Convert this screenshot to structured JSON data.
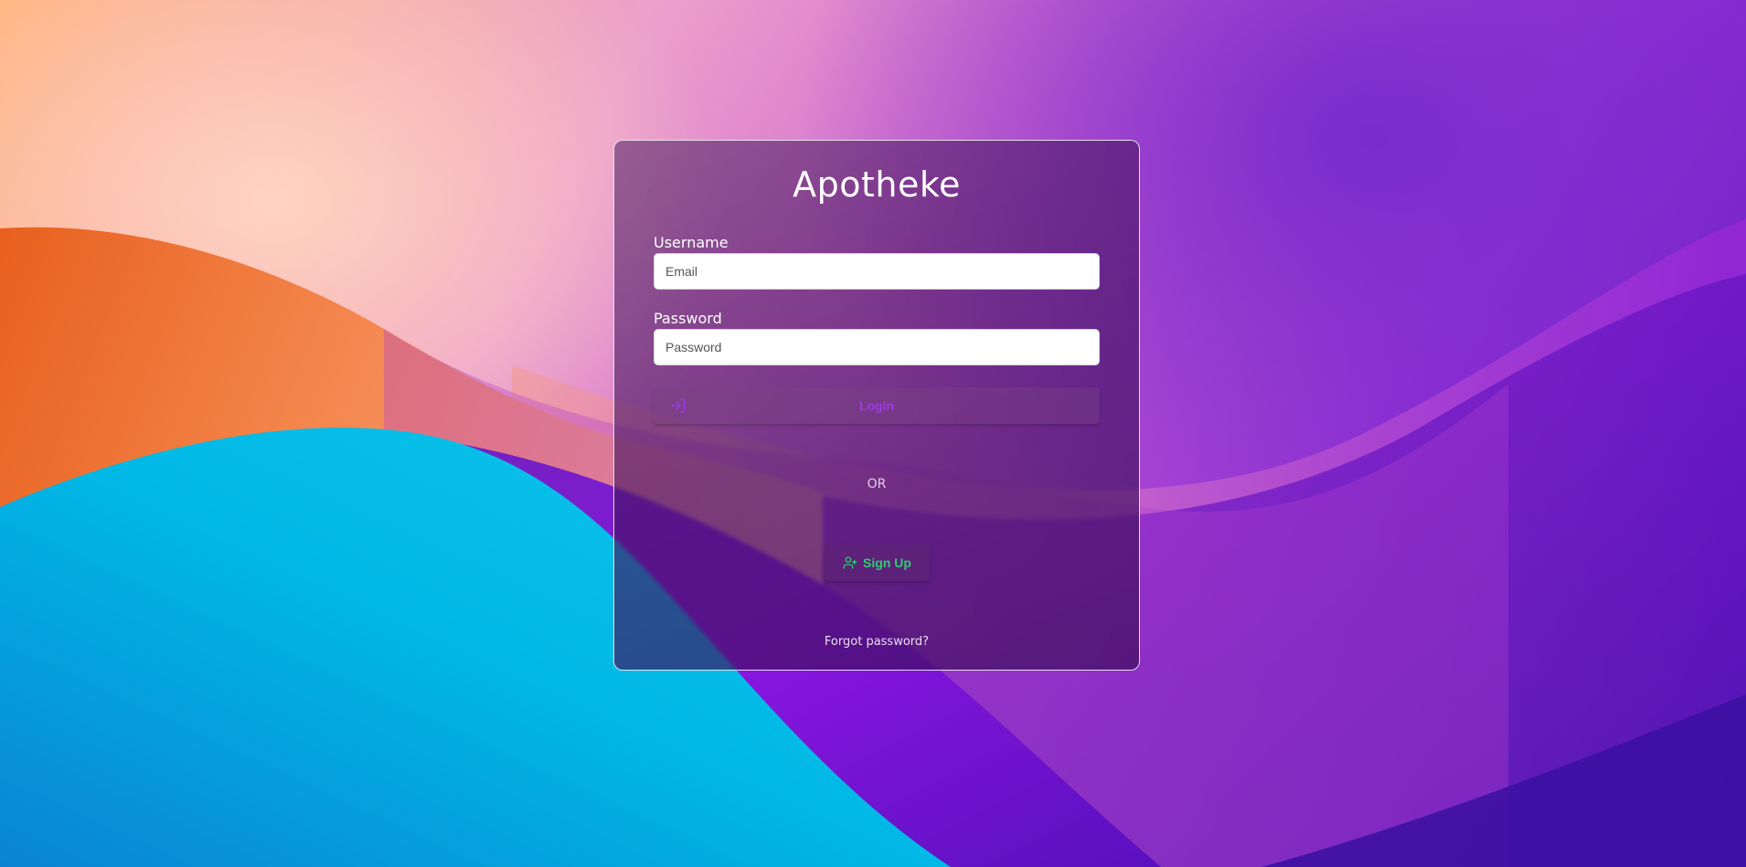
{
  "app": {
    "title": "Apotheke"
  },
  "form": {
    "username_label": "Username",
    "username_placeholder": "Email",
    "username_value": "",
    "password_label": "Password",
    "password_placeholder": "Password",
    "password_value": "",
    "login_label": "Login",
    "login_icon": "login-arrow-icon",
    "or_text": "OR",
    "signup_label": "Sign Up",
    "signup_icon": "user-plus-icon",
    "forgot_label": "Forgot password?"
  },
  "colors": {
    "login_text": "#a039e6",
    "signup_text": "#2ecc71",
    "card_border": "#ffffff"
  }
}
